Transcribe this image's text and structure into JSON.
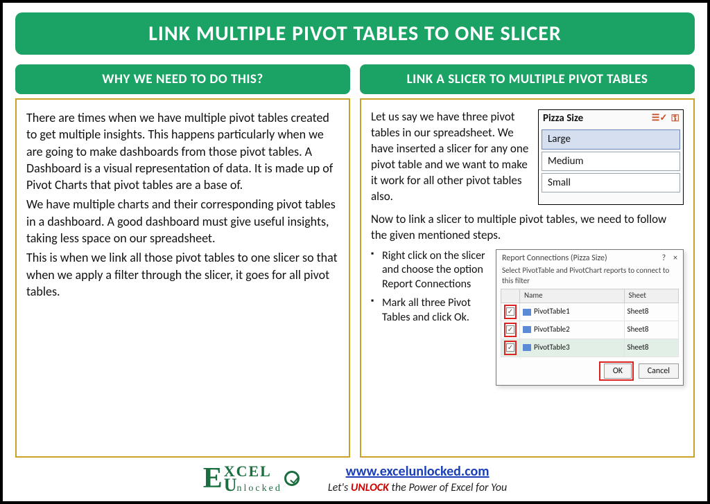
{
  "title": "LINK MULTIPLE PIVOT TABLES TO ONE SLICER",
  "left": {
    "header": "WHY WE NEED TO DO THIS?",
    "p1": "There are times when we have multiple pivot tables created to get multiple insights. This happens particularly when we are going to make dashboards from those pivot tables. A Dashboard is a visual representation of data. It is made up of Pivot Charts that pivot tables are a base of.",
    "p2": "We have multiple charts and their corresponding pivot tables in a dashboard. A good dashboard must give useful insights, taking less space on our spreadsheet.",
    "p3": "This is when we link all those pivot tables to one slicer so that when we apply a filter through the slicer, it goes for all pivot tables."
  },
  "right": {
    "header": "LINK A SLICER TO MULTIPLE PIVOT TABLES",
    "intro": "Let us say we have three pivot tables in our spreadsheet. We have inserted a slicer for any one pivot table and we want to make it work for all other pivot tables also.",
    "mid": "Now to link a slicer to multiple pivot tables, we need to follow the given mentioned steps.",
    "step1": "Right click on the slicer and choose the option Report Connections",
    "step2": "Mark all three Pivot Tables and click Ok."
  },
  "slicer": {
    "title": "Pizza Size",
    "items": [
      "Large",
      "Medium",
      "Small"
    ]
  },
  "dialog": {
    "title": "Report Connections (Pizza Size)",
    "close": "×",
    "question": "?",
    "sub": "Select PivotTable and PivotChart reports to connect to this filter",
    "col_name": "Name",
    "col_sheet": "Sheet",
    "rows": [
      {
        "name": "PivotTable1",
        "sheet": "Sheet8"
      },
      {
        "name": "PivotTable2",
        "sheet": "Sheet8"
      },
      {
        "name": "PivotTable3",
        "sheet": "Sheet8"
      }
    ],
    "ok": "OK",
    "cancel": "Cancel"
  },
  "footer": {
    "brand_top": "XCEL",
    "brand_bot": "nlocked",
    "site": "www.excelunlocked.com",
    "slogan_pre": "Let's ",
    "slogan_unlock": "UNLOCK",
    "slogan_post": " the Power of Excel for You"
  }
}
